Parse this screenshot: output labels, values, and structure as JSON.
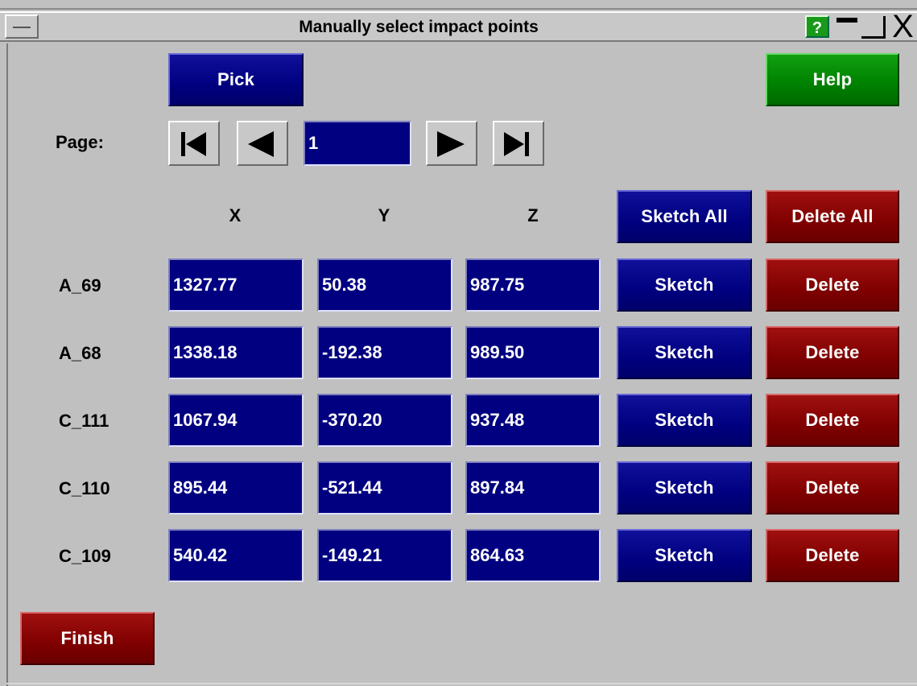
{
  "window": {
    "title": "Manually select impact points",
    "help_glyph": "?",
    "close_glyph": "X"
  },
  "toolbar": {
    "pick_label": "Pick",
    "help_label": "Help"
  },
  "pager": {
    "label": "Page:",
    "page_value": "1",
    "icons": [
      "first-page-icon",
      "prev-page-icon",
      "next-page-icon",
      "last-page-icon"
    ]
  },
  "columns": {
    "x": "X",
    "y": "Y",
    "z": "Z",
    "sketch_all_label": "Sketch All",
    "delete_all_label": "Delete All"
  },
  "rows": [
    {
      "name": "A_69",
      "x": "1327.77",
      "y": "50.38",
      "z": "987.75",
      "sketch": "Sketch",
      "delete": "Delete"
    },
    {
      "name": "A_68",
      "x": "1338.18",
      "y": "-192.38",
      "z": "989.50",
      "sketch": "Sketch",
      "delete": "Delete"
    },
    {
      "name": "C_111",
      "x": "1067.94",
      "y": "-370.20",
      "z": "937.48",
      "sketch": "Sketch",
      "delete": "Delete"
    },
    {
      "name": "C_110",
      "x": "895.44",
      "y": "-521.44",
      "z": "897.84",
      "sketch": "Sketch",
      "delete": "Delete"
    },
    {
      "name": "C_109",
      "x": "540.42",
      "y": "-149.21",
      "z": "864.63",
      "sketch": "Sketch",
      "delete": "Delete"
    }
  ],
  "footer": {
    "finish_label": "Finish"
  },
  "colors": {
    "blue_button": "#000080",
    "red_button": "#800000",
    "green_button": "#008000",
    "panel_bg": "#c0c0c0"
  }
}
